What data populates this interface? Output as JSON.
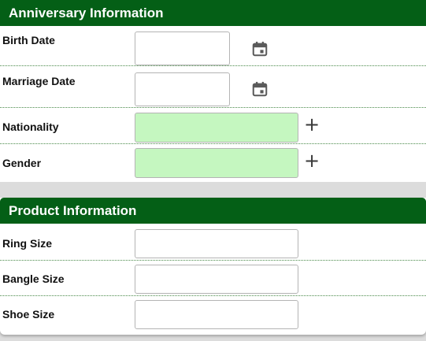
{
  "anniversary": {
    "title": "Anniversary Information",
    "birth_date": {
      "label": "Birth Date",
      "value": ""
    },
    "marriage_date": {
      "label": "Marriage Date",
      "value": ""
    },
    "nationality": {
      "label": "Nationality",
      "value": ""
    },
    "gender": {
      "label": "Gender",
      "value": ""
    }
  },
  "product": {
    "title": "Product Information",
    "ring_size": {
      "label": "Ring Size",
      "value": ""
    },
    "bangle_size": {
      "label": "Bangle Size",
      "value": ""
    },
    "shoe_size": {
      "label": "Shoe Size",
      "value": ""
    }
  },
  "icons": {
    "calendar": "calendar-icon",
    "add": "plus-icon",
    "add_glyph": "+"
  },
  "colors": {
    "header_bg": "#045f16",
    "header_text": "#ffffff",
    "lookup_field_bg": "#c5f7c0",
    "separator": "#4a8a4a"
  }
}
